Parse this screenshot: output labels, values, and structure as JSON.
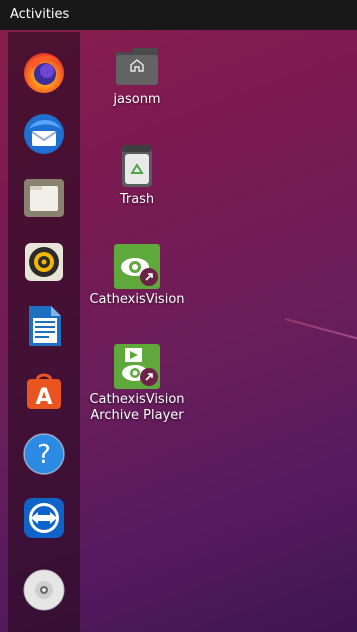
{
  "topbar": {
    "activities_label": "Activities"
  },
  "dock": {
    "items": [
      {
        "name": "firefox"
      },
      {
        "name": "thunderbird"
      },
      {
        "name": "files"
      },
      {
        "name": "rhythmbox"
      },
      {
        "name": "libreoffice-writer"
      },
      {
        "name": "ubuntu-software"
      },
      {
        "name": "help"
      },
      {
        "name": "teamviewer"
      },
      {
        "name": "optical-drive"
      }
    ]
  },
  "desktop": {
    "items": [
      {
        "label": "jasonm",
        "icon": "home-folder-icon"
      },
      {
        "label": "Trash",
        "icon": "trash-icon"
      },
      {
        "label": "CathexisVision",
        "icon": "cathexisvision-icon"
      },
      {
        "label_line1": "CathexisVision",
        "label_line2": "Archive Player",
        "icon": "archive-player-icon"
      }
    ]
  },
  "colors": {
    "topbar": "#181818",
    "wallpaper_top": "#8a1e4e",
    "wallpaper_bottom": "#3e1550",
    "cathexis_green": "#5fa83c"
  }
}
